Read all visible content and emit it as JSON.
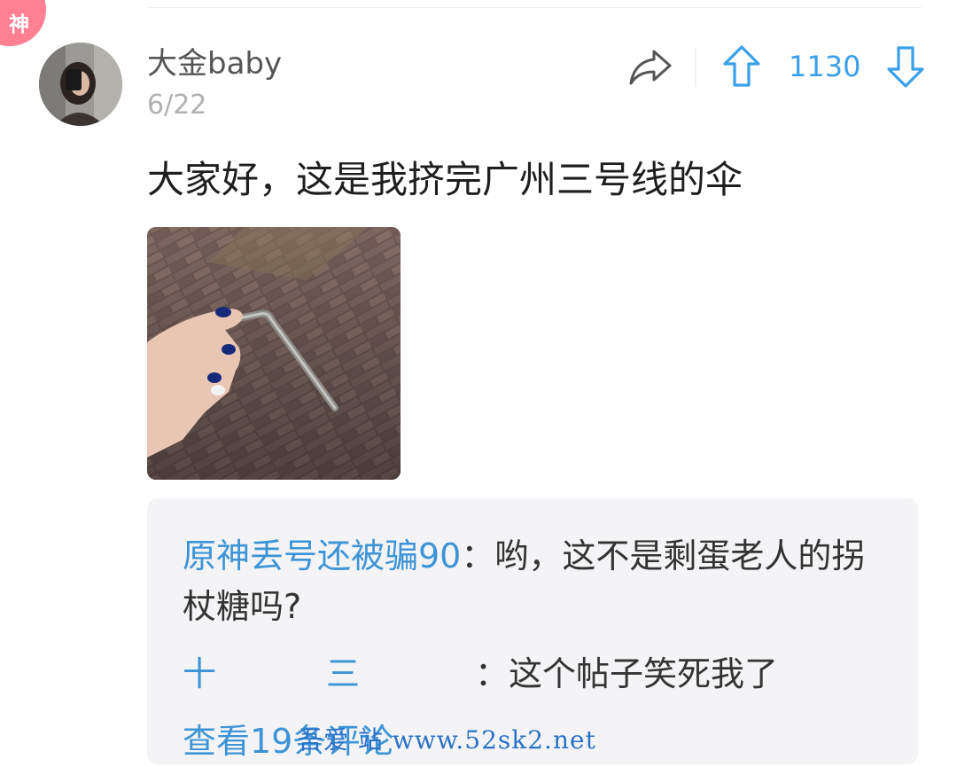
{
  "badge": {
    "label": "神",
    "color": "#ff7f93"
  },
  "post": {
    "author": "大金baby",
    "date": "6/22",
    "text": "大家好，这是我挤完广州三号线的伞",
    "vote_count": "1130",
    "icons": {
      "share": "share-arrow-icon",
      "upvote": "arrow-up-icon",
      "downvote": "arrow-down-icon"
    },
    "accent_color": "#3aa0ea"
  },
  "comments": [
    {
      "author": "原神丢号还被骗90",
      "separator": "：",
      "text": "哟，这不是剩蛋老人的拐杖糖吗?"
    },
    {
      "author_first": "十",
      "author_second": "三",
      "separator": "：",
      "text": "这个帖子笑死我了"
    }
  ],
  "view_more": "查看19条评论",
  "watermark": "吾爱 站 www.52sk2.net"
}
